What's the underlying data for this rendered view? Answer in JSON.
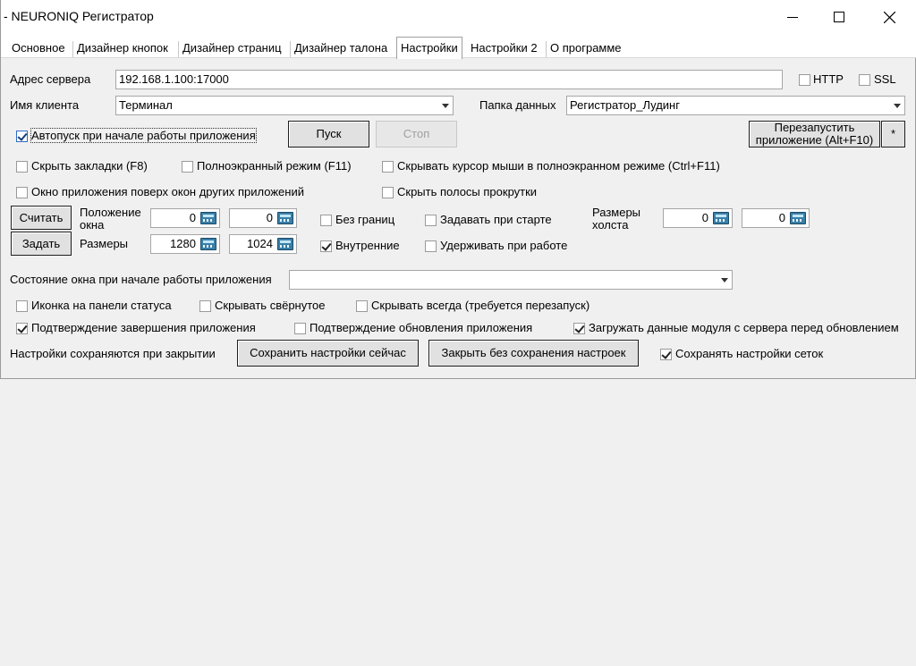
{
  "window": {
    "title": "- NEURONIQ Регистратор"
  },
  "tabs": [
    "Основное",
    "Дизайнер кнопок",
    "Дизайнер страниц",
    "Дизайнер талона",
    "Настройки",
    "Настройки 2",
    "О программе"
  ],
  "active_tab": "Настройки",
  "server": {
    "label": "Адрес сервера",
    "value": "192.168.1.100:17000",
    "http_label": "HTTP",
    "ssl_label": "SSL"
  },
  "client": {
    "label": "Имя клиента",
    "value": "Терминал"
  },
  "data_folder": {
    "label": "Папка данных",
    "value": "Регистратор_Лудинг"
  },
  "autostart": {
    "label": "Автопуск при начале работы приложения",
    "checked": true,
    "start_label": "Пуск",
    "stop_label": "Стоп"
  },
  "restart": {
    "label": "Перезапустить приложение (Alt+F10)",
    "star_label": "*"
  },
  "options_row1": {
    "hide_tabs": "Скрыть закладки (F8)",
    "fullscreen": "Полноэкранный режим (F11)",
    "hide_cursor": "Скрывать курсор мыши в полноэкранном режиме (Ctrl+F11)"
  },
  "options_row2": {
    "on_top": "Окно приложения поверх окон других приложений",
    "hide_scrollbars": "Скрыть полосы прокрутки"
  },
  "geometry": {
    "read_label": "Считать",
    "set_label": "Задать",
    "position_label": "Положение окна",
    "size_label": "Размеры",
    "pos_x": "0",
    "pos_y": "0",
    "width": "1280",
    "height": "1024",
    "no_border": "Без границ",
    "internal": "Внутренние",
    "set_on_start": "Задавать при старте",
    "keep_on_work": "Удерживать при работе",
    "canvas_label": "Размеры холста",
    "canvas_w": "0",
    "canvas_h": "0"
  },
  "window_state": {
    "label": "Состояние окна при начале работы приложения",
    "value": ""
  },
  "options_row3": {
    "tray_icon": "Иконка на панели статуса",
    "hide_minimized": "Скрывать свёрнутое",
    "hide_always": "Скрывать всегда (требуется перезапуск)"
  },
  "options_row4": {
    "confirm_exit": "Подтверждение завершения приложения",
    "confirm_update": "Подтверждение обновления приложения",
    "load_module": "Загружать данные модуля с сервера перед обновлением"
  },
  "save": {
    "note": "Настройки сохраняются при закрытии",
    "save_now": "Сохранить настройки сейчас",
    "close_no_save": "Закрыть без сохранения настроек",
    "save_grids": "Сохранять настройки сеток"
  }
}
